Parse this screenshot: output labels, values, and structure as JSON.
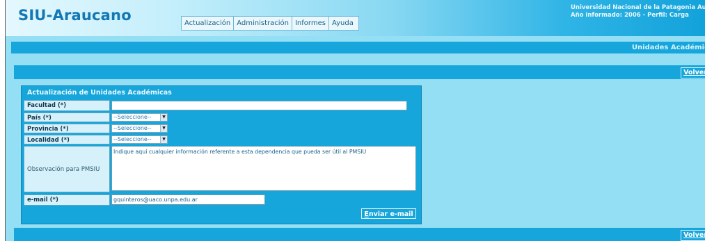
{
  "header": {
    "logo": "SIU-Araucano",
    "menu": [
      "Actualización",
      "Administración",
      "Informes",
      "Ayuda"
    ],
    "university": "Universidad Nacional de la Patagonia Austral",
    "year_profile": "Año informado: 2006 - Perfil: Carga"
  },
  "page_title": "Unidades Académic",
  "buttons": {
    "back": "Volver",
    "send_first": "E",
    "send_rest": "nviar e-mail"
  },
  "form": {
    "title": "Actualización de Unidades Académicas",
    "facultad": {
      "label": "Facultad (*)",
      "value": ""
    },
    "pais": {
      "label": "País (*)",
      "value": "--Seleccione--"
    },
    "provincia": {
      "label": "Provincia (*)",
      "value": "--Seleccione--"
    },
    "localidad": {
      "label": "Localidad (*)",
      "value": "--Seleccione--"
    },
    "observacion": {
      "label": "Observación para PMSIU",
      "value": "Indique aquí cualquier información referente a esta dependencia que pueda ser útil al PMSIU"
    },
    "email": {
      "label": "e-mail (*)",
      "value": "gquinteros@uaco.unpa.edu.ar"
    }
  },
  "colors": {
    "bar": "#16a6dc",
    "background": "#95dff5",
    "label_bg": "#d7f1fa"
  }
}
